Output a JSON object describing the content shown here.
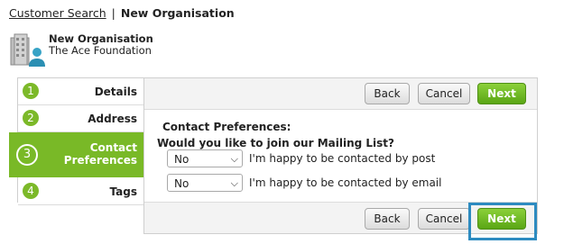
{
  "breadcrumb": {
    "link": "Customer Search",
    "separator": "|",
    "current": "New Organisation"
  },
  "org": {
    "name": "New Organisation",
    "subtitle": "The Ace Foundation",
    "icon": "organisation-building-icon"
  },
  "steps": [
    {
      "num": "1",
      "label": "Details"
    },
    {
      "num": "2",
      "label": "Address"
    },
    {
      "num": "3",
      "label_line1": "Contact",
      "label_line2": "Preferences",
      "active": true
    },
    {
      "num": "4",
      "label": "Tags"
    }
  ],
  "toolbar": {
    "back": "Back",
    "cancel": "Cancel",
    "next": "Next"
  },
  "form": {
    "title": "Contact Preferences:",
    "question": "Would you like to join our Mailing List?",
    "post_value": "No",
    "post_label": "I'm happy to be contacted by post",
    "email_value": "No",
    "email_label": "I'm happy to be contacted by email"
  },
  "colors": {
    "accent_green": "#79b927",
    "highlight_blue": "#2d8bc0"
  }
}
